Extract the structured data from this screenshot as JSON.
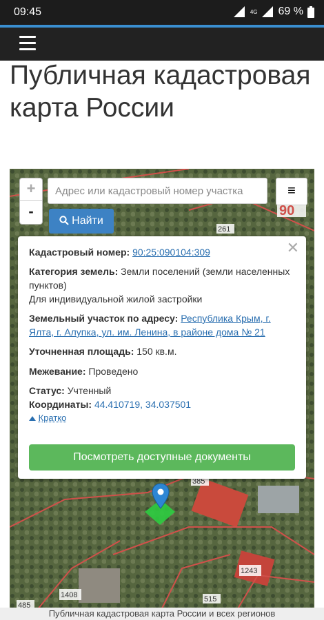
{
  "status_bar": {
    "time": "09:45",
    "network": "4G",
    "battery": "69 %"
  },
  "page": {
    "title": "Публичная кадастровая карта России"
  },
  "map": {
    "zoom_in": "+",
    "zoom_out": "-",
    "search_placeholder": "Адрес или кадастровый номер участка",
    "menu_icon": "≡",
    "find_label": "Найти",
    "parcel_labels": [
      "90",
      "261",
      "385",
      "1243",
      "1408",
      "515",
      "485"
    ],
    "popup": {
      "cadastral_label": "Кадастровый номер:",
      "cadastral_value": "90:25:090104:309",
      "category_label": "Категория земель:",
      "category_value": "Земли поселений (земли населенных пунктов)",
      "usage": "Для индивидуальной жилой застройки",
      "address_label": "Земельный участок по адресу:",
      "address_value": "Республика Крым, г. Ялта, г. Алупка, ул. им. Ленина, в районе дома № 21",
      "area_label": "Уточненная площадь:",
      "area_value": "150 кв.м.",
      "survey_label": "Межевание:",
      "survey_value": "Проведено",
      "status_label": "Статус:",
      "status_value": "Учтенный",
      "coords_label": "Координаты:",
      "coords_value": "44.410719, 34.037501",
      "brief_label": "Кратко",
      "docs_button": "Посмотреть доступные документы"
    }
  },
  "footer": {
    "text": "Публичная кадастровая карта России и всех регионов"
  }
}
